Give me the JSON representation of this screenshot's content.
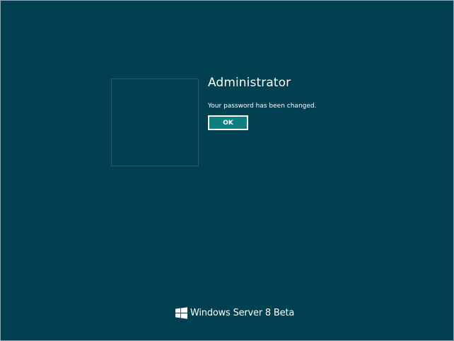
{
  "user": {
    "name": "Administrator"
  },
  "dialog": {
    "message": "Your password has been changed.",
    "ok_label": "OK"
  },
  "branding": {
    "product_name": "Windows Server 8 Beta",
    "logo_icon": "windows-logo-icon"
  },
  "colors": {
    "background": "#004050",
    "button_fill": "#0c7f7f",
    "text": "#ffffff"
  }
}
